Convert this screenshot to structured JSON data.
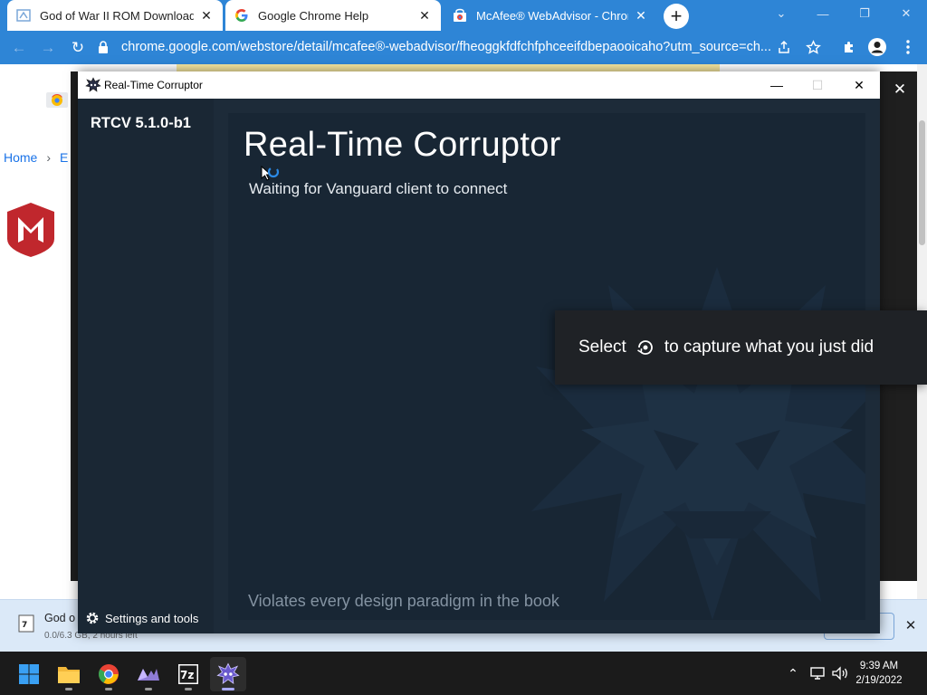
{
  "browser": {
    "tabs": [
      {
        "title": "God of War II ROM Download - R",
        "icon": "site-favicon",
        "active": false
      },
      {
        "title": "Google Chrome Help",
        "icon": "google-g-icon",
        "active": false
      },
      {
        "title": "McAfee® WebAdvisor - Chrome",
        "icon": "chrome-web-store-icon",
        "active": true
      }
    ],
    "new_tab_label": "+",
    "url": "chrome.google.com/webstore/detail/mcafee®-webadvisor/fheoggkfdfchfphceeifdbepaooicaho?utm_source=ch..."
  },
  "page": {
    "breadcrumb": [
      "Home",
      "E"
    ]
  },
  "download": {
    "name": "God o",
    "meta": "0.0/6.3 GB, 2 hours left"
  },
  "rtc": {
    "window_title": "Real-Time Corruptor",
    "version": "RTCV 5.1.0-b1",
    "heading": "Real-Time Corruptor",
    "status": "Waiting for Vanguard client to connect",
    "footer": "Violates every design paradigm in the book",
    "settings_label": "Settings and tools"
  },
  "toast": {
    "before": "Select",
    "after": "to capture what you just did",
    "icon": "capture-icon"
  },
  "taskbar": {
    "apps": [
      "start-icon",
      "file-explorer-icon",
      "chrome-icon",
      "app-icon",
      "7zip-icon",
      "rtc-icon"
    ],
    "time": "9:39 AM",
    "date": "2/19/2022"
  },
  "colors": {
    "chrome_accent": "#2e85d6",
    "rtc_bg": "#1c2a38",
    "mcafee_red": "#c0272d"
  }
}
